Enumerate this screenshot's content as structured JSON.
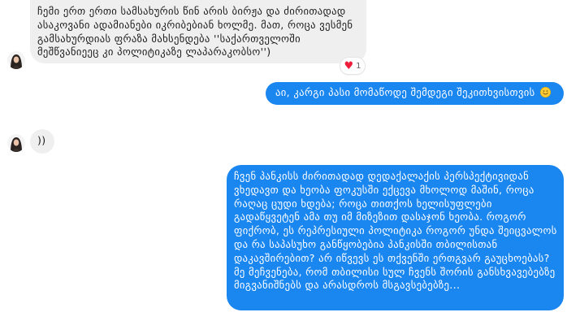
{
  "messages": [
    {
      "direction": "incoming",
      "text": "ჩემი ერთ ერთი სამსახურის წინ არის ბირჟა და ძირითადად ასაკოვანი ადამიანები იკრიბებიან ხოლმე. მათ, როცა ვესმენ გამსახურდიას ფრაზა მახსენდება ''საქართველოში მეშწვანიეეც კი პოლიტიკაზე ლაპარაკობსო'')"
    },
    {
      "direction": "outgoing",
      "text": "აი, კარგი პასი მომაწოდე შემდეგი შეკითხვისთვის",
      "emoji": "smiling-face-emoji"
    },
    {
      "direction": "incoming",
      "text": "))"
    },
    {
      "direction": "outgoing",
      "text": "ჩვენ პანკისს ძირითადად დედაქალაქის პერსპექტივიდან ვხედავთ და ხეობა ფოკუსში ექცევა მხოლოდ მაშინ, როცა რაღაც ცუდი ხდება; როცა თითქოს ხელისუფლები გადაწყვეტენ ამა თუ იმ მიზეზით დასაჯონ ხეობა. როგორ ფიქრობ, ეს რეპრესიული პოლიტიკა როგორ უნდა შეიცვალოს და რა საპასუხო განწყობებია პანკისში თბილისთან დაკავშირებით? არ იწვევს ეს თქვენში ერთგვარ გაუცხოებას? მე მეჩვენება, რომ თბილისი სულ ჩვენს შორის განსხვავებებზე მიგვანიშნებს და არასდროს მსგავსებებზე..."
    }
  ],
  "reaction": {
    "icon": "heart-icon",
    "count": "1"
  },
  "colors": {
    "incoming_bubble": "#efefef",
    "outgoing_bubble": "#1a86f0",
    "heart": "#ee1d3a"
  }
}
